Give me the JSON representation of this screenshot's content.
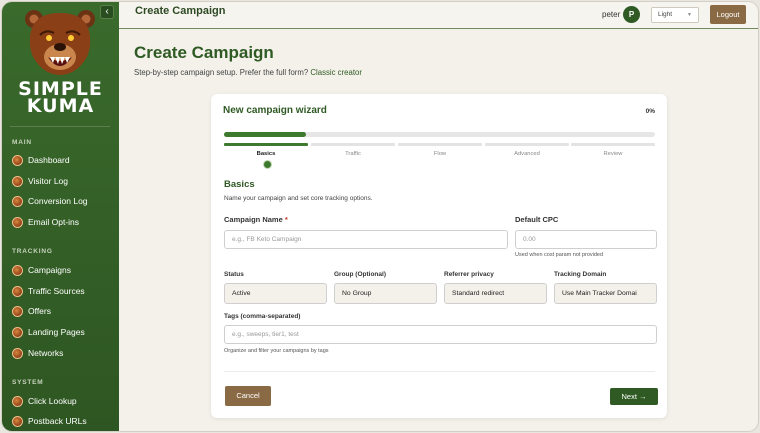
{
  "brand": {
    "line1": "SIMPLE",
    "line2": "KUMA"
  },
  "sidebar": {
    "collapse_icon": "chevron-left-icon",
    "sections": [
      {
        "title": "MAIN",
        "items": [
          {
            "label": "Dashboard",
            "icon": "bear-icon"
          },
          {
            "label": "Visitor Log",
            "icon": "bear-icon"
          },
          {
            "label": "Conversion Log",
            "icon": "bear-icon"
          },
          {
            "label": "Email Opt-ins",
            "icon": "bear-icon"
          }
        ]
      },
      {
        "title": "TRACKING",
        "items": [
          {
            "label": "Campaigns",
            "icon": "bear-icon"
          },
          {
            "label": "Traffic Sources",
            "icon": "bear-icon"
          },
          {
            "label": "Offers",
            "icon": "bear-icon"
          },
          {
            "label": "Landing Pages",
            "icon": "bear-icon"
          },
          {
            "label": "Networks",
            "icon": "bear-icon"
          }
        ]
      },
      {
        "title": "SYSTEM",
        "items": [
          {
            "label": "Click Lookup",
            "icon": "bear-icon"
          },
          {
            "label": "Postback URLs",
            "icon": "bear-icon"
          }
        ]
      }
    ]
  },
  "topbar": {
    "title": "Create Campaign",
    "username": "peter",
    "avatar_initial": "P",
    "theme": "Light",
    "logout_label": "Logout"
  },
  "main": {
    "title": "Create Campaign",
    "subtitle": "Step-by-step campaign setup. Prefer the full form?",
    "subtitle_link": "Classic creator"
  },
  "wizard": {
    "title": "New campaign wizard",
    "progress_label": "0%",
    "progress_fraction": 0.19,
    "steps": [
      "Basics",
      "Traffic",
      "Flow",
      "Advanced",
      "Review"
    ],
    "active_step": 0,
    "section_heading": "Basics",
    "section_desc": "Name your campaign and set core tracking options.",
    "campaign_name": {
      "label": "Campaign Name",
      "required_mark": "*",
      "placeholder": "e.g., FB Keto Campaign",
      "value": ""
    },
    "default_cpc": {
      "label": "Default CPC",
      "placeholder": "0.00",
      "value": "",
      "help": "Used when cost param not provided"
    },
    "status": {
      "label": "Status",
      "value": "Active"
    },
    "group": {
      "label": "Group (Optional)",
      "value": "No Group"
    },
    "referrer": {
      "label": "Referrer privacy",
      "value": "Standard redirect"
    },
    "tracking_domain": {
      "label": "Tracking Domain",
      "value": "Use Main Tracker Domai"
    },
    "tags": {
      "label": "Tags (comma-separated)",
      "placeholder": "e.g., sweeps, tier1, test",
      "help": "Organize and filter your campaigns by tags"
    },
    "cancel_label": "Cancel",
    "next_label": "Next →"
  },
  "colors": {
    "accent": "#2f5a24",
    "brown": "#8a6a45",
    "sidebar": "#2e5622"
  }
}
